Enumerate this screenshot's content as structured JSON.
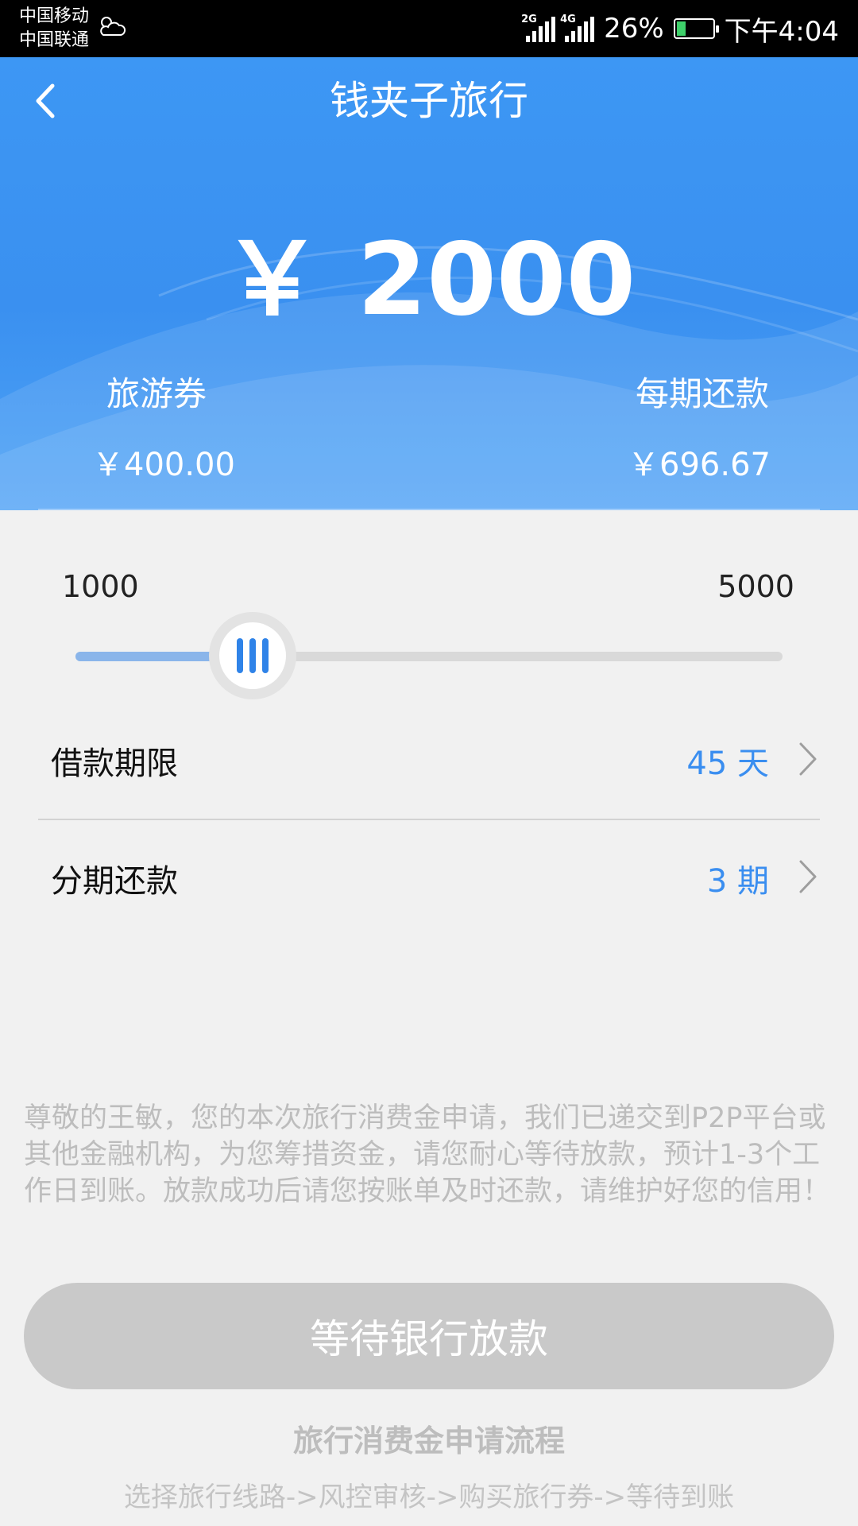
{
  "status_bar": {
    "carrier_1": "中国移动",
    "carrier_2": "中国联通",
    "net_1": "2G",
    "net_2": "4G",
    "battery_percent": "26%",
    "battery_level": 0.26,
    "time": "下午4:04"
  },
  "header": {
    "title": "钱夹子旅行"
  },
  "hero": {
    "amount": "￥ 2000",
    "voucher_label": "旅游券",
    "voucher_value": "￥400.00",
    "installment_label": "每期还款",
    "installment_value": "￥696.67"
  },
  "slider": {
    "min_label": "1000",
    "max_label": "5000",
    "fraction": 0.25
  },
  "rows": {
    "term_label": "借款期限",
    "term_value": "45 天",
    "installments_label": "分期还款",
    "installments_value": "3 期"
  },
  "notice": "尊敬的王敏，您的本次旅行消费金申请，我们已递交到P2P平台或其他金融机构，为您筹措资金，请您耐心等待放款，预计1-3个工作日到账。放款成功后请您按账单及时还款，请维护好您的信用！",
  "submit_label": "等待银行放款",
  "flow": {
    "title": "旅行消费金申请流程",
    "steps": "选择旅行线路->风控审核->购买旅行券->等待到账"
  },
  "colors": {
    "header_blue": "#3d97f4",
    "accent_blue": "#3a8ef0",
    "button_disabled": "#c9c9c9"
  }
}
